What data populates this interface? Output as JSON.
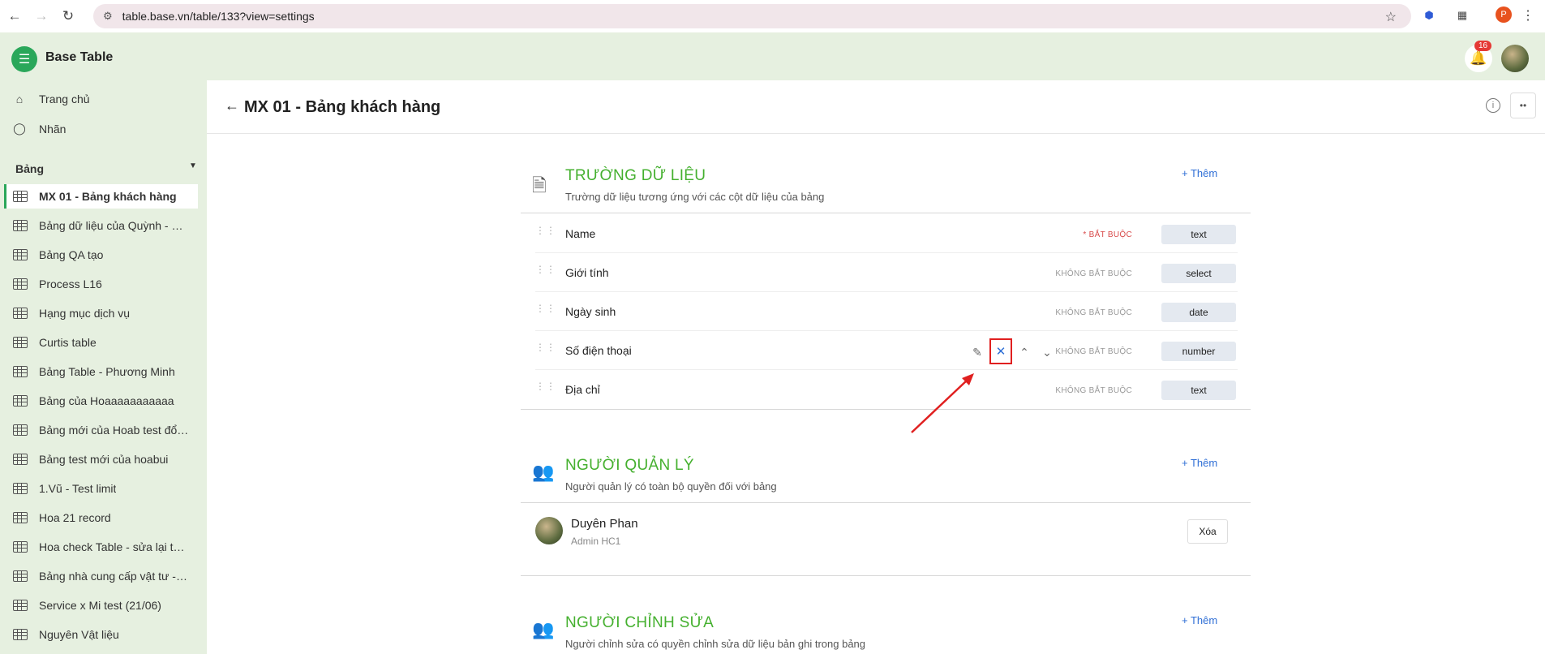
{
  "browser": {
    "url": "table.base.vn/table/133?view=settings",
    "profile_initial": "P"
  },
  "app": {
    "title": "Base Table",
    "notification_count": "16"
  },
  "sidebar": {
    "nav": [
      {
        "label": "Trang chủ",
        "icon": "home-icon"
      },
      {
        "label": "Nhãn",
        "icon": "tag-icon"
      }
    ],
    "section_label": "Bảng",
    "tables": [
      {
        "label": "MX 01 - Bảng khách hàng",
        "active": true
      },
      {
        "label": "Bảng dữ liệu của Quỳnh - KHÁCH HÀNG",
        "active": false
      },
      {
        "label": "Bảng QA tạo",
        "active": false
      },
      {
        "label": "Process L16",
        "active": false
      },
      {
        "label": "Hạng mục dịch vụ",
        "active": false
      },
      {
        "label": "Curtis table",
        "active": false
      },
      {
        "label": "Bảng Table - Phương Minh",
        "active": false
      },
      {
        "label": "Bảng của Hoaaaaaaaaaaa",
        "active": false
      },
      {
        "label": "Bảng mới của Hoab test đổi tên",
        "active": false
      },
      {
        "label": "Bảng test mới của hoabui",
        "active": false
      },
      {
        "label": "1.Vũ - Test limit",
        "active": false
      },
      {
        "label": "Hoa 21 record",
        "active": false
      },
      {
        "label": "Hoa check Table - sửa lại tên bảng",
        "active": false
      },
      {
        "label": "Bảng nhà cung cấp vật tư - CE",
        "active": false
      },
      {
        "label": "Service x Mi test (21/06)",
        "active": false
      },
      {
        "label": "Nguyên Vật liệu",
        "active": false
      }
    ]
  },
  "page": {
    "title": "MX 01 - Bảng khách hàng"
  },
  "fields_section": {
    "title": "TRƯỜNG DỮ LIỆU",
    "subtitle": "Trường dữ liệu tương ứng với các cột dữ liệu của bảng",
    "add_label": "+ Thêm",
    "fields": [
      {
        "name": "Name",
        "required": "* BẮT BUỘC",
        "type": "text",
        "is_required": true
      },
      {
        "name": "Giới tính",
        "required": "KHÔNG BẮT BUỘC",
        "type": "select",
        "is_required": false
      },
      {
        "name": "Ngày sinh",
        "required": "KHÔNG BẮT BUỘC",
        "type": "date",
        "is_required": false
      },
      {
        "name": "Số điện thoại",
        "required": "KHÔNG BẮT BUỘC",
        "type": "number",
        "is_required": false
      },
      {
        "name": "Địa chỉ",
        "required": "KHÔNG BẮT BUỘC",
        "type": "text",
        "is_required": false
      }
    ]
  },
  "managers_section": {
    "title": "NGƯỜI QUẢN LÝ",
    "subtitle": "Người quản lý có toàn bộ quyền đối với bảng",
    "add_label": "+ Thêm",
    "managers": [
      {
        "name": "Duyên Phan",
        "role": "Admin HC1",
        "remove_label": "Xóa"
      }
    ]
  },
  "editors_section": {
    "title": "NGƯỜI CHỈNH SỬA",
    "subtitle": "Người chỉnh sửa có quyền chỉnh sửa dữ liệu bản ghi trong bảng",
    "add_label": "+ Thêm"
  },
  "colors": {
    "accent_green": "#45b02f",
    "link_blue": "#2f6fd6",
    "sidebar_bg": "#e6f0e0",
    "highlight_red": "#e02020"
  }
}
